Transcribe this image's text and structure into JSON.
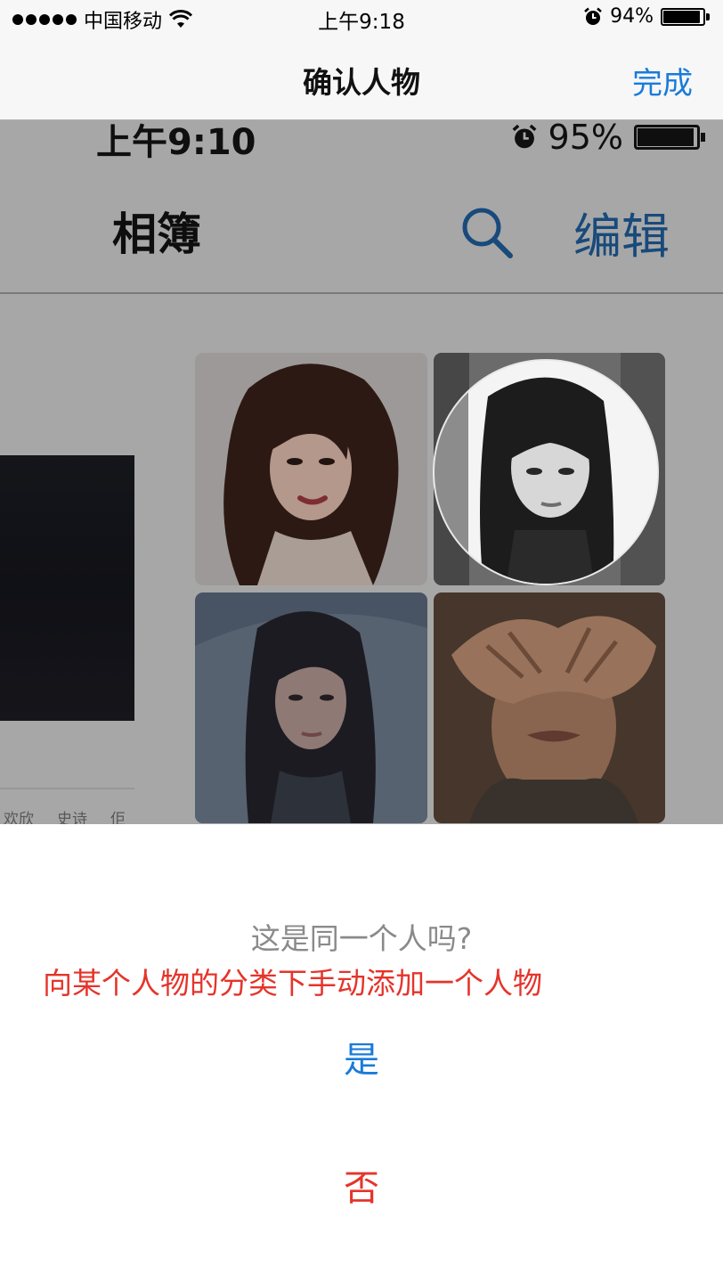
{
  "status_bar": {
    "carrier": "中国移动",
    "time": "上午9:18",
    "battery_text": "94%",
    "battery_level": 0.94,
    "icons": [
      "signal-dots-icon",
      "wifi-icon",
      "alarm-icon",
      "battery-icon"
    ]
  },
  "nav": {
    "title": "确认人物",
    "done_label": "完成"
  },
  "embedded": {
    "time": "上午9:10",
    "battery_text": "95%",
    "battery_level": 0.95,
    "title": "相簿",
    "edit_label": "编辑",
    "album_captions": [
      "欢欣",
      "史诗",
      "佢"
    ],
    "icons": [
      "search-icon",
      "alarm-icon",
      "battery-icon"
    ]
  },
  "prompt": {
    "question": "这是同一个人吗?",
    "annotation": "向某个人物的分类下手动添加一个人物",
    "yes_label": "是",
    "no_label": "否"
  },
  "colors": {
    "accent_blue": "#1a7bd9",
    "alert_red": "#e5342b",
    "question_gray": "#8a8a8a",
    "bar_background": "#f7f7f7"
  }
}
